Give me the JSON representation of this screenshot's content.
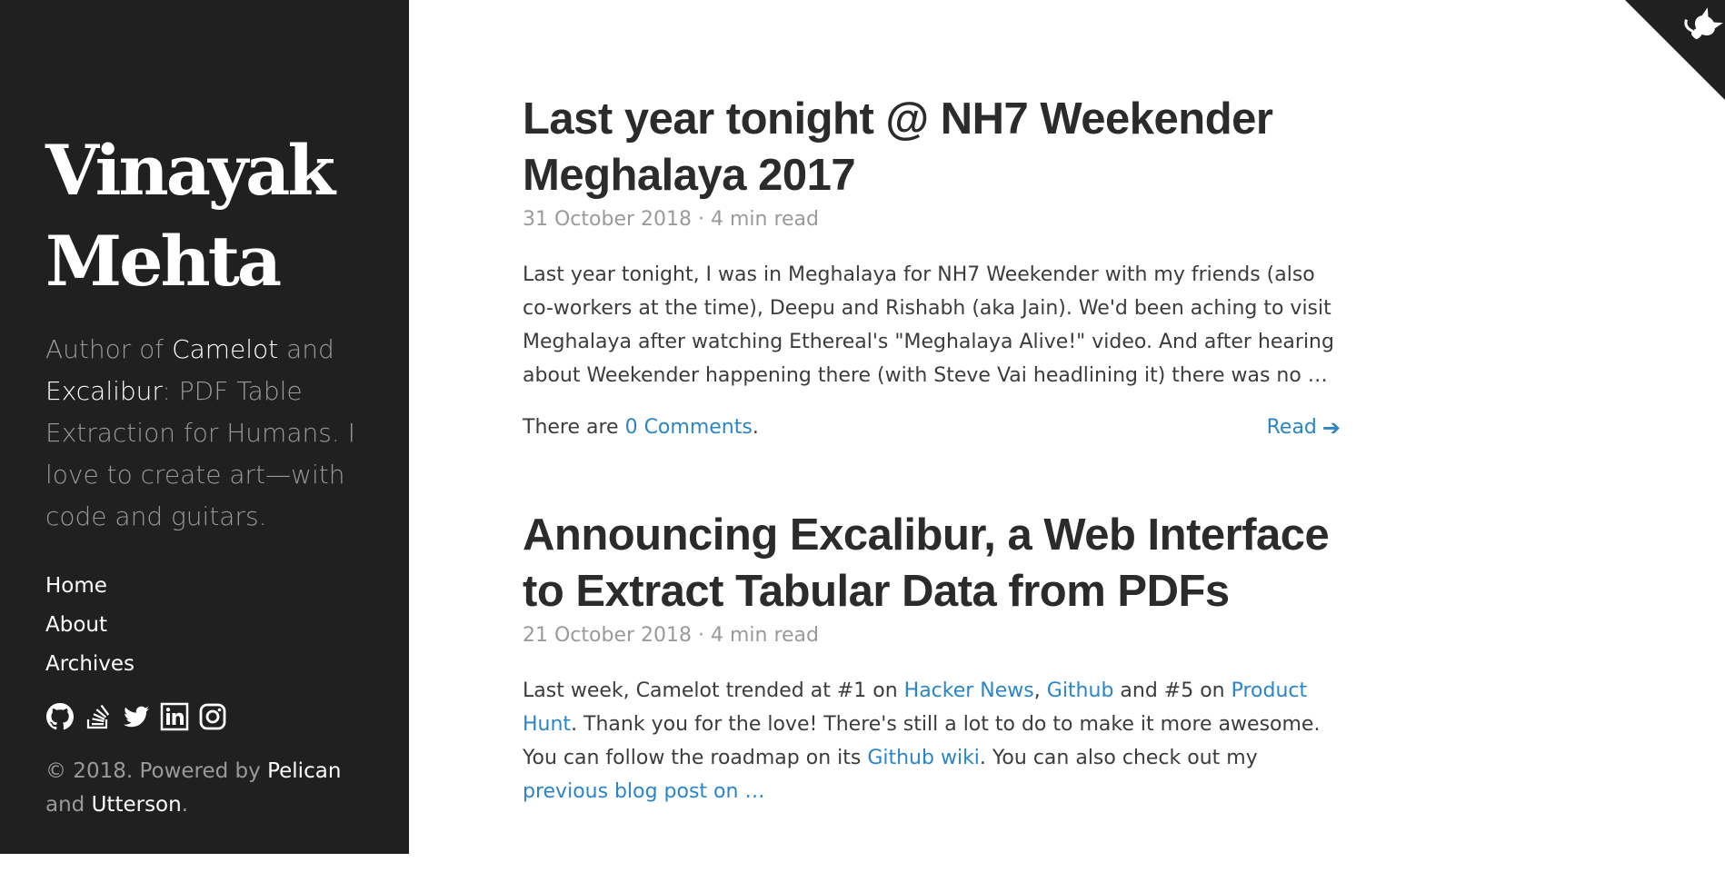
{
  "sidebar": {
    "title_line1": "Vinayak",
    "title_line2": "Mehta",
    "tagline": {
      "t1": "Author of ",
      "camelot": "Camelot",
      "t2": " and ",
      "excalibur": "Excalibur",
      "t3": ": PDF Table Extraction for Humans. I love to create art—with code and guitars."
    },
    "nav": [
      {
        "label": "Home"
      },
      {
        "label": "About"
      },
      {
        "label": "Archives"
      }
    ],
    "social_icons": [
      "github-icon",
      "stackoverflow-icon",
      "twitter-icon",
      "linkedin-icon",
      "instagram-icon"
    ],
    "footer": {
      "t1": "© 2018. Powered by ",
      "pelican": "Pelican",
      "t2": " and ",
      "utterson": "Utterson",
      "t3": "."
    }
  },
  "posts": [
    {
      "title": "Last year tonight @ NH7 Weekender Meghalaya 2017",
      "meta": "31 October 2018 · 4 min read",
      "excerpt": "Last year tonight, I was in Meghalaya for NH7 Weekender with my friends (also co-workers at the time), Deepu and Rishabh (aka Jain). We'd been aching to visit Meghalaya after watching Ethereal's \"Meghalaya Alive!\" video. And after hearing about Weekender happening there (with Steve Vai headlining it) there was no …",
      "comments_prefix": "There are ",
      "comments_link": "0 Comments",
      "comments_suffix": ".",
      "read_label": "Read"
    },
    {
      "title": "Announcing Excalibur, a Web Interface to Extract Tabular Data from PDFs",
      "meta": "21 October 2018 · 4 min read",
      "excerpt_parts": {
        "p1": "Last week, Camelot trended at #1 on ",
        "l1": "Hacker News",
        "p2": ", ",
        "l2": "Github",
        "p3": " and #5 on ",
        "l3": "Product Hunt",
        "p4": ". Thank you for the love! There's still a lot to do to make it more awesome. You can follow the roadmap on its ",
        "l4": "Github wiki",
        "p5": ". You can also check out my ",
        "l5": "previous blog post on …"
      }
    }
  ],
  "colors": {
    "sidebar_bg": "#202020",
    "link": "#2a85c9",
    "title": "#2b2b2b"
  },
  "corner_icon": "github-corner-icon"
}
